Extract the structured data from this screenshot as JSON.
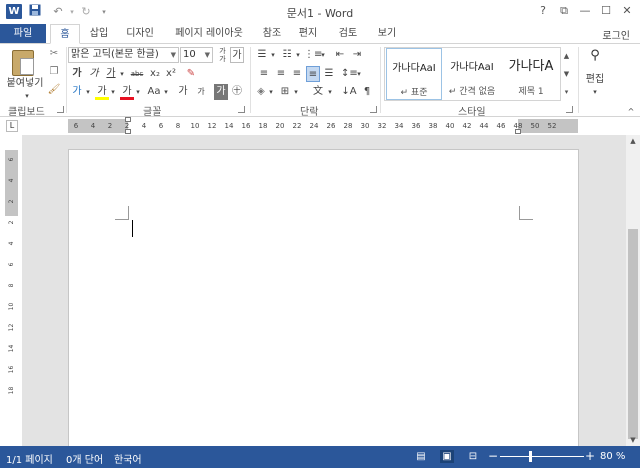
{
  "window": {
    "title": "문서1 - Word",
    "help": "?",
    "restore_ribbon": "⧉",
    "minimize": "—",
    "maximize": "☐",
    "close": "✕"
  },
  "quick_access": {
    "app_icon": "W",
    "save_icon": "save-icon",
    "undo_icon": "undo-icon",
    "redo_icon": "redo-icon",
    "customize_icon": "chevron-down-icon"
  },
  "tabs": [
    {
      "label": "파일"
    },
    {
      "label": "홈"
    },
    {
      "label": "삽입"
    },
    {
      "label": "디자인"
    },
    {
      "label": "페이지 레이아웃"
    },
    {
      "label": "참조"
    },
    {
      "label": "편지"
    },
    {
      "label": "검토"
    },
    {
      "label": "보기"
    }
  ],
  "account": "로그인",
  "ribbon": {
    "clipboard": {
      "label": "클립보드",
      "paste": "붙여넣기"
    },
    "font": {
      "label": "글꼴",
      "font_name": "맑은 고딕(본문 한글)",
      "font_size": "10",
      "bold": "가",
      "italic": "가",
      "underline": "가",
      "strike": "abc",
      "subscript": "x₂",
      "superscript": "x²",
      "text_effect": "가",
      "highlight": "가",
      "font_color": "가",
      "change_case": "Aa",
      "grow": "가",
      "shrink": "가",
      "char_border": "가",
      "enclose": "㊉"
    },
    "paragraph": {
      "label": "단락"
    },
    "styles": {
      "label": "스타일",
      "items": [
        {
          "sample": "가나다AaI",
          "name": "↵ 표준"
        },
        {
          "sample": "가나다AaI",
          "name": "↵ 간격 없음"
        },
        {
          "sample": "가나다A",
          "name": "제목 1"
        }
      ]
    },
    "editing": {
      "label": "편집"
    }
  },
  "ruler": {
    "corner": "L",
    "h_ticks": [
      "6",
      "4",
      "2",
      "2",
      "4",
      "6",
      "8",
      "10",
      "12",
      "14",
      "16",
      "18",
      "20",
      "22",
      "24",
      "26",
      "28",
      "30",
      "32",
      "34",
      "36",
      "38",
      "40",
      "42",
      "44",
      "46",
      "48",
      "50",
      "52"
    ],
    "v_ticks": [
      "6",
      "4",
      "2",
      "2",
      "4",
      "6",
      "8",
      "10",
      "12",
      "14",
      "16",
      "18"
    ]
  },
  "status": {
    "page": "1/1 페이지",
    "words": "0개 단어",
    "language": "한국어",
    "zoom_minus": "−",
    "zoom_plus": "+",
    "zoom": "80 %",
    "zoom_level_percent": 80
  },
  "colors": {
    "accent": "#2b579a",
    "font_color_bar": "#e81123",
    "highlight_bar": "#ffff00"
  }
}
